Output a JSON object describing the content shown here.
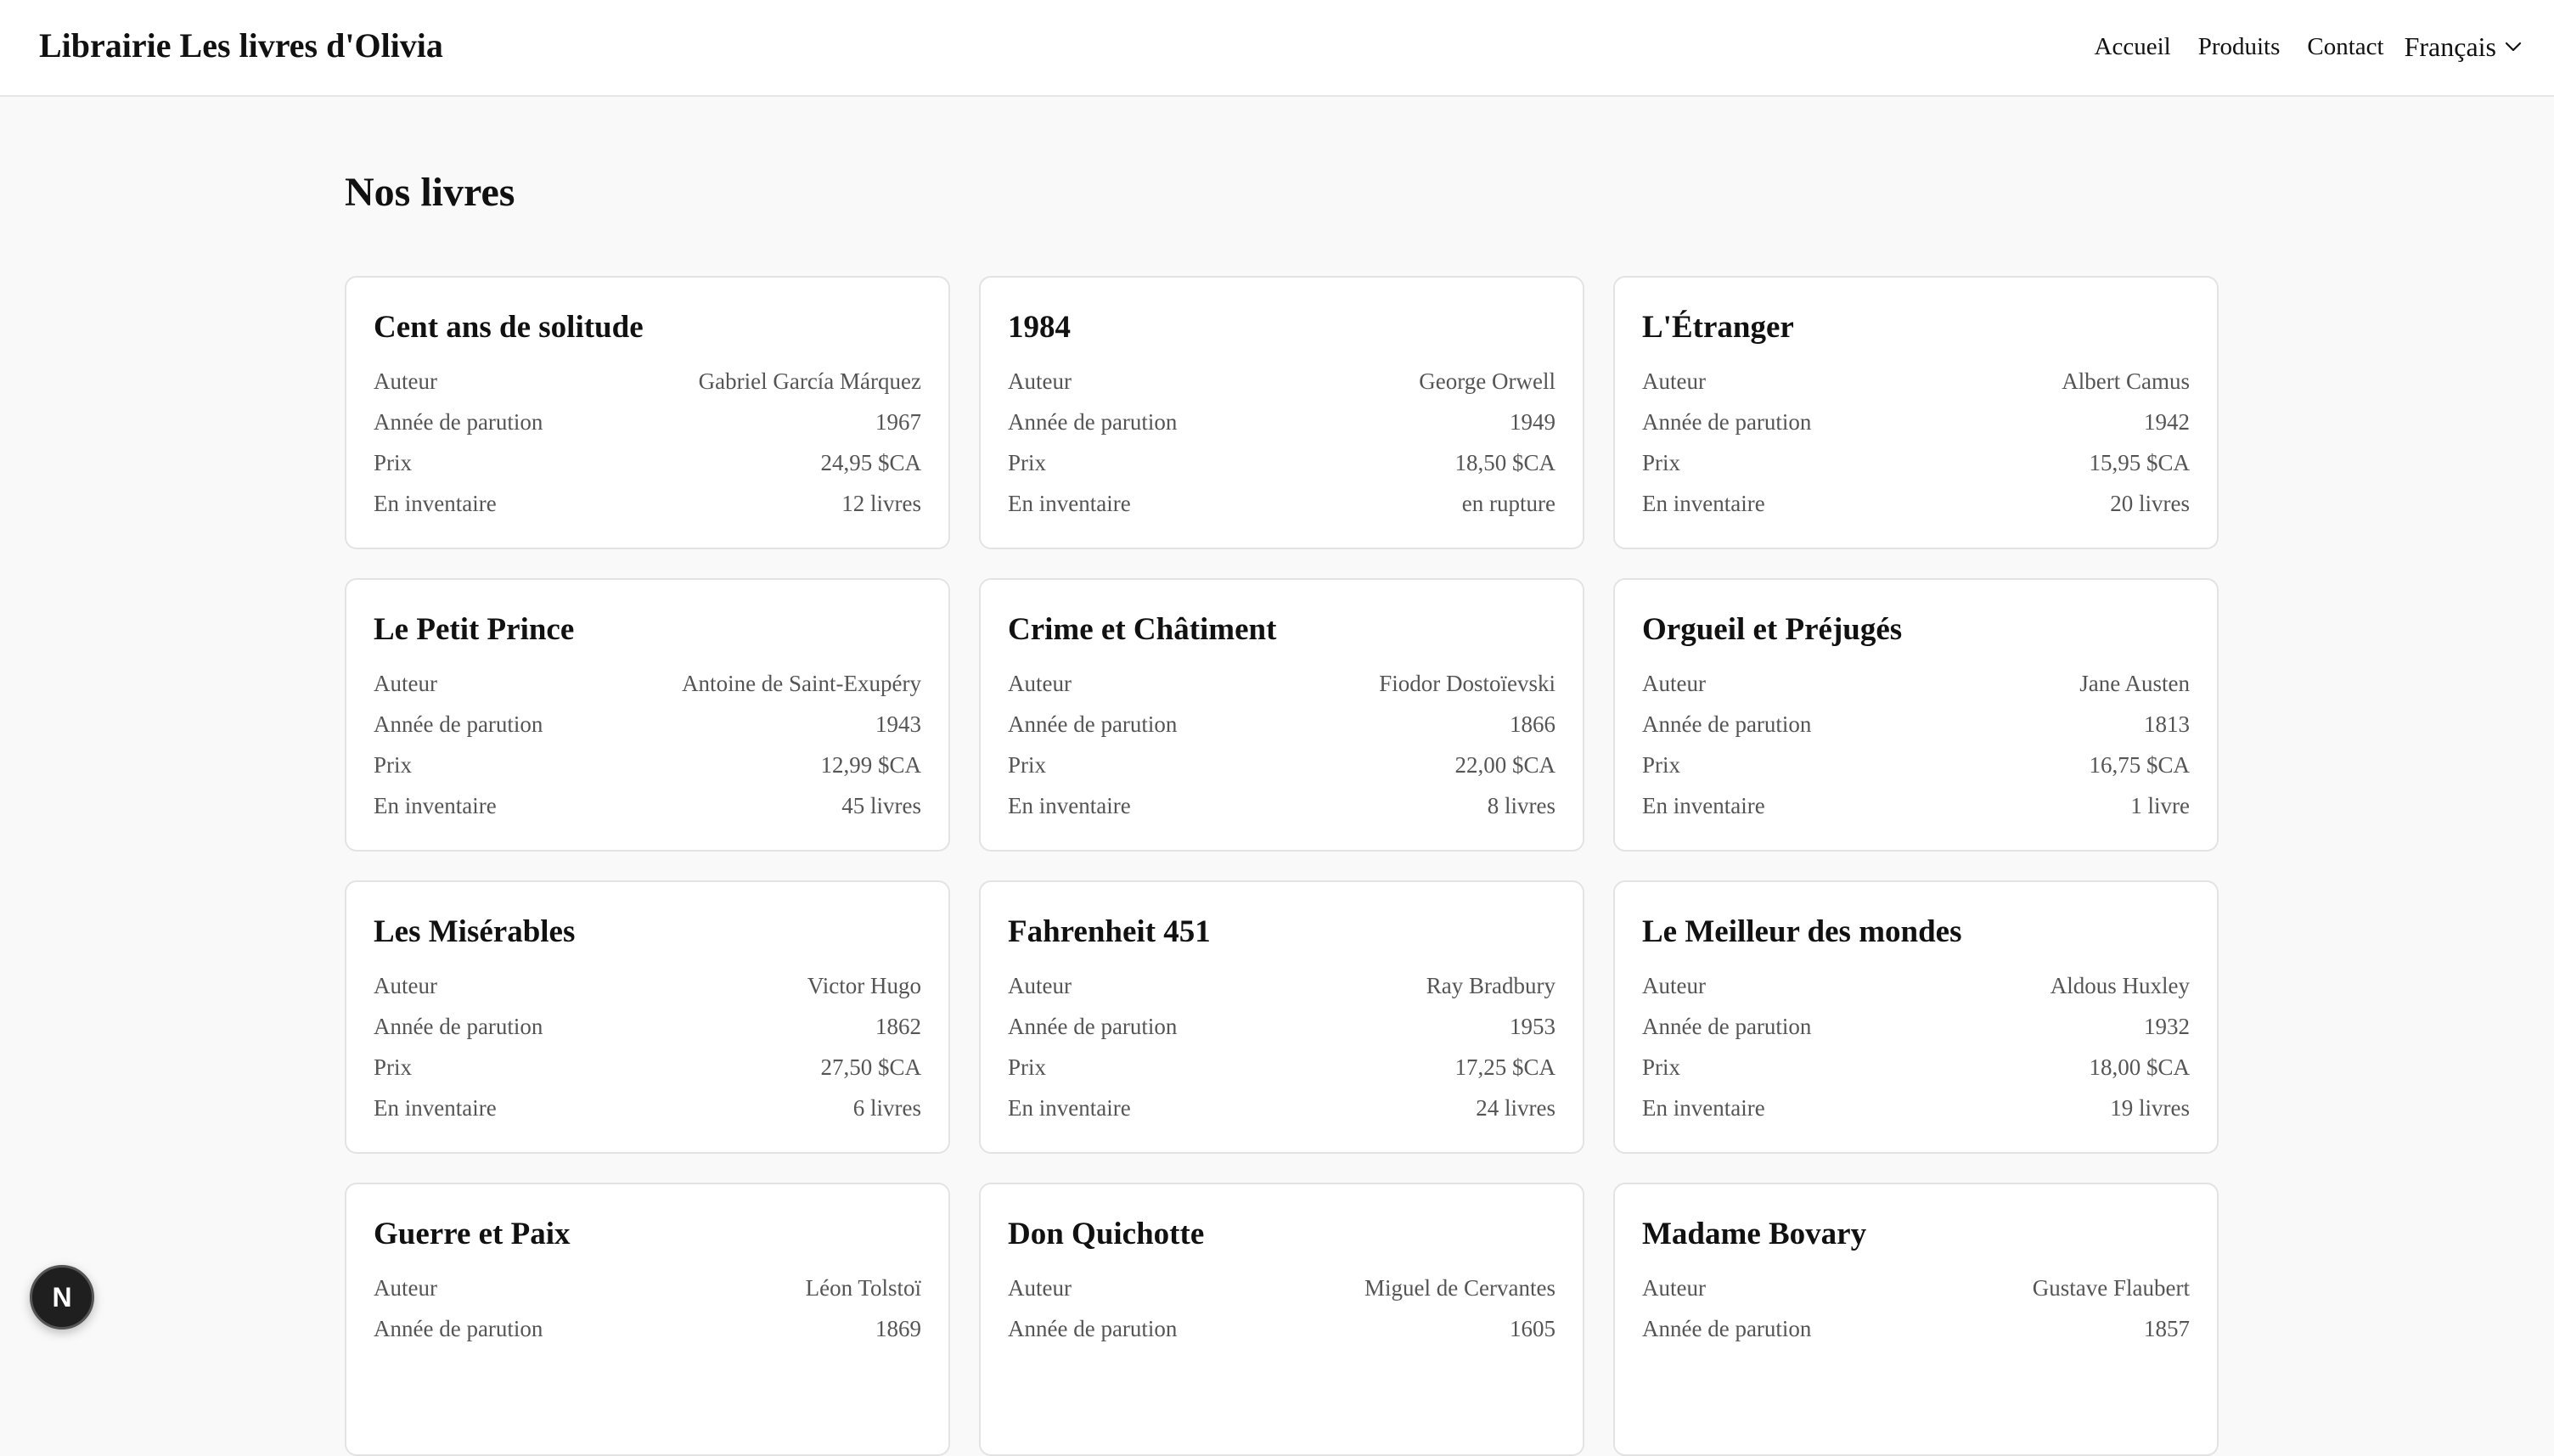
{
  "header": {
    "brand": "Librairie Les livres d'Olivia",
    "nav": {
      "home": "Accueil",
      "products": "Produits",
      "contact": "Contact"
    },
    "language": "Français"
  },
  "main": {
    "title": "Nos livres"
  },
  "labels": {
    "author": "Auteur",
    "year": "Année de parution",
    "price": "Prix",
    "stock": "En inventaire"
  },
  "books": [
    {
      "title": "Cent ans de solitude",
      "author": "Gabriel García Márquez",
      "year": "1967",
      "price": "24,95 $CA",
      "stock": "12 livres"
    },
    {
      "title": "1984",
      "author": "George Orwell",
      "year": "1949",
      "price": "18,50 $CA",
      "stock": "en rupture"
    },
    {
      "title": "L'Étranger",
      "author": "Albert Camus",
      "year": "1942",
      "price": "15,95 $CA",
      "stock": "20 livres"
    },
    {
      "title": "Le Petit Prince",
      "author": "Antoine de Saint-Exupéry",
      "year": "1943",
      "price": "12,99 $CA",
      "stock": "45 livres"
    },
    {
      "title": "Crime et Châtiment",
      "author": "Fiodor Dostoïevski",
      "year": "1866",
      "price": "22,00 $CA",
      "stock": "8 livres"
    },
    {
      "title": "Orgueil et Préjugés",
      "author": "Jane Austen",
      "year": "1813",
      "price": "16,75 $CA",
      "stock": "1 livre"
    },
    {
      "title": "Les Misérables",
      "author": "Victor Hugo",
      "year": "1862",
      "price": "27,50 $CA",
      "stock": "6 livres"
    },
    {
      "title": "Fahrenheit 451",
      "author": "Ray Bradbury",
      "year": "1953",
      "price": "17,25 $CA",
      "stock": "24 livres"
    },
    {
      "title": "Le Meilleur des mondes",
      "author": "Aldous Huxley",
      "year": "1932",
      "price": "18,00 $CA",
      "stock": "19 livres"
    },
    {
      "title": "Guerre et Paix",
      "author": "Léon Tolstoï",
      "year": "1869"
    },
    {
      "title": "Don Quichotte",
      "author": "Miguel de Cervantes",
      "year": "1605"
    },
    {
      "title": "Madame Bovary",
      "author": "Gustave Flaubert",
      "year": "1857"
    }
  ],
  "dev_badge": {
    "label": "N",
    "icon": "nextjs-icon"
  }
}
